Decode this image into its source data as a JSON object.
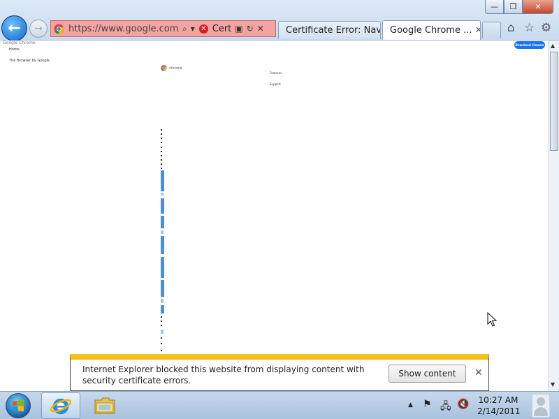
{
  "window": {
    "minimize_label": "—",
    "restore_label": "❐",
    "close_label": "✕"
  },
  "navigation": {
    "back_label": "←",
    "forward_label": "→"
  },
  "address_bar": {
    "url": "https://www.google.com/chr",
    "search_glyph": "⌕",
    "dropdown_glyph": "▾",
    "cert_error_label": "Cert",
    "compat_glyph": "▣",
    "refresh_glyph": "↻",
    "stop_glyph": "✕",
    "status_color": "#f4a3a3"
  },
  "tabs": [
    {
      "label": "Certificate Error: Nav...",
      "close": "",
      "active": false
    },
    {
      "label": "Google Chrome ...",
      "close": "✕",
      "active": true
    }
  ],
  "commands": {
    "home_glyph": "⌂",
    "favorites_glyph": "☆",
    "tools_glyph": "⚙"
  },
  "page": {
    "site_name": "Google Chrome",
    "download_button": "Download Chrome",
    "nav_home": "Home",
    "tagline": "The Browser by Google",
    "logo_text": "chrome",
    "nav_features": "Features",
    "nav_support": "Support"
  },
  "scrollbar": {
    "up_arrow": "▲",
    "down_arrow": "▼",
    "position": 0.0
  },
  "notification": {
    "message": "Internet Explorer blocked this website from displaying content with security certificate errors.",
    "show_content_button": "Show content",
    "close_glyph": "✕",
    "accent_color": "#f2c11a"
  },
  "taskbar": {
    "tray_up_arrow": "▲",
    "flag_glyph": "⚑",
    "network_glyph": "🖧",
    "volume_glyph": "🔇",
    "time": "10:27 AM",
    "date": "2/14/2011"
  }
}
